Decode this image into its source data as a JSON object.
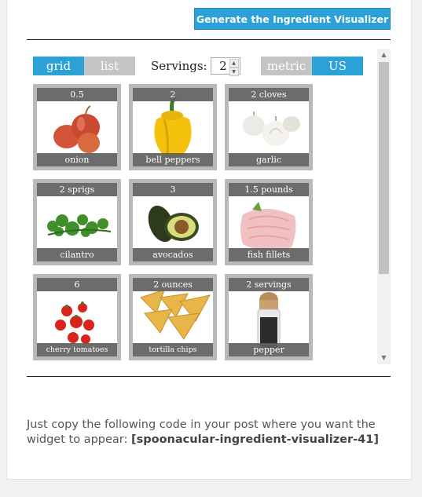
{
  "header": {
    "generate_button": "Generate the Ingredient Visualizer"
  },
  "view_toggle": {
    "grid": "grid",
    "list": "list"
  },
  "servings": {
    "label": "Servings:",
    "value": "2"
  },
  "unit_toggle": {
    "metric": "metric",
    "us": "US"
  },
  "ingredients": [
    {
      "amount": "0.5",
      "name": "onion",
      "icon": "onion"
    },
    {
      "amount": "2",
      "name": "bell peppers",
      "icon": "bell-pepper"
    },
    {
      "amount": "2 cloves",
      "name": "garlic",
      "icon": "garlic"
    },
    {
      "amount": "2 sprigs",
      "name": "cilantro",
      "icon": "cilantro"
    },
    {
      "amount": "3",
      "name": "avocados",
      "icon": "avocado"
    },
    {
      "amount": "1.5 pounds",
      "name": "fish fillets",
      "icon": "fish-fillet"
    },
    {
      "amount": "6",
      "name": "cherry tomatoes",
      "icon": "cherry-tomato"
    },
    {
      "amount": "2 ounces",
      "name": "tortilla chips",
      "icon": "tortilla-chip"
    },
    {
      "amount": "2 servings",
      "name": "pepper",
      "icon": "pepper-grinder"
    }
  ],
  "footer": {
    "instruction": "Just copy the following code in your post where you want the widget to appear:",
    "shortcode": "[spoonacular-ingredient-visualizer-41]"
  },
  "colors": {
    "accent": "#2ba1d6",
    "inactive": "#c4c4c4",
    "tile_frame": "#b9b9b9"
  }
}
